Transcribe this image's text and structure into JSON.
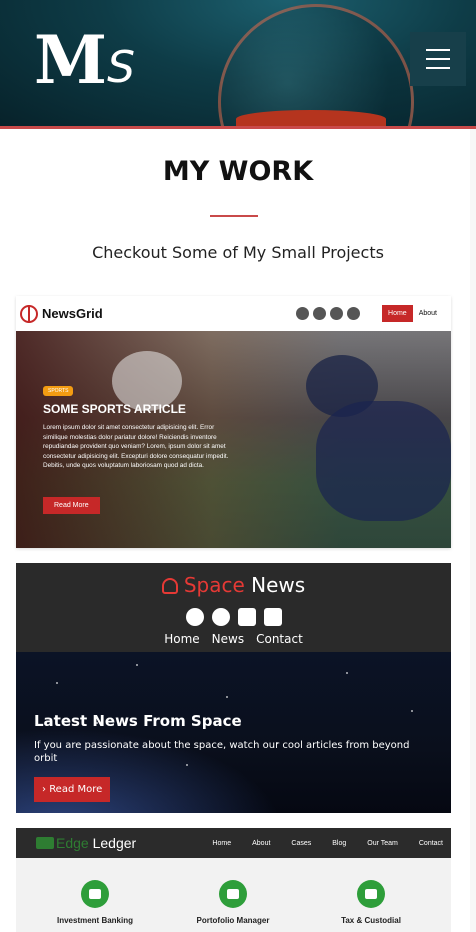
{
  "header": {
    "logo_big": "M",
    "logo_small": "S",
    "menu_icon": "hamburger-icon"
  },
  "section": {
    "title": "MY WORK",
    "subtitle": "Checkout Some of My Small Projects"
  },
  "colors": {
    "accent": "#c94a4a",
    "hero_dark": "#0e3c47",
    "project_red": "#c62828",
    "edge_green": "#2e9e3a"
  },
  "projects": [
    {
      "brand": "NewsGrid",
      "nav": [
        "Home",
        "About"
      ],
      "badge": "SPORTS",
      "headline": "SOME SPORTS ARTICLE",
      "body": "Lorem ipsum dolor sit amet consectetur adipisicing elit. Error similique molestias dolor pariatur dolore! Reiciendis inventore repudiandae provident quo veniam? Lorem, ipsum dolor sit amet consectetur adipisicing elit. Excepturi dolore consequatur impedit. Debitis, unde quos voluptatum laboriosam quod ad dicta.",
      "button": "Read More",
      "social_icons": [
        "facebook-icon",
        "twitter-icon",
        "instagram-icon",
        "youtube-icon"
      ]
    },
    {
      "brand_red": "Space",
      "brand_white": "News",
      "nav": [
        "Home",
        "News",
        "Contact"
      ],
      "headline": "Latest News From Space",
      "body": "If you are passionate about the space, watch our cool articles from beyond orbit",
      "button": "Read More",
      "social_icons": [
        "facebook-icon",
        "twitter-icon",
        "instagram-icon",
        "linkedin-icon"
      ]
    },
    {
      "brand_green": "Edge",
      "brand_white": "Ledger",
      "nav": [
        "Home",
        "About",
        "Cases",
        "Blog",
        "Our Team",
        "Contact"
      ],
      "features": [
        "Investment Banking",
        "Portofolio Manager",
        "Tax & Custodial"
      ]
    }
  ]
}
